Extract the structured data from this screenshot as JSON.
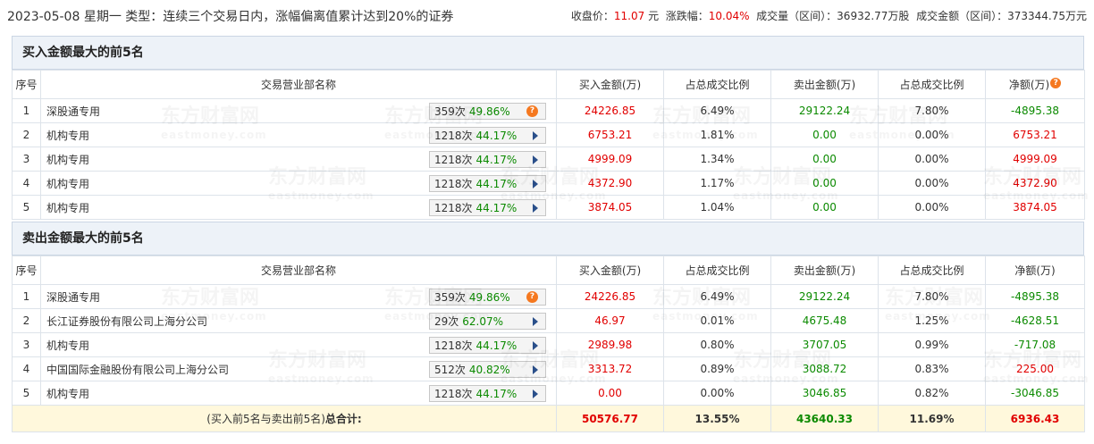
{
  "header": {
    "date": "2023-05-08",
    "weekday": "星期一",
    "type_label": "类型：",
    "type_value": "连续三个交易日内，涨幅偏离值累计达到20%的证券",
    "close_label": "收盘价：",
    "close_value": "11.07",
    "close_unit": "元",
    "change_label": "涨跌幅：",
    "change_value": "10.04%",
    "volume_label": "成交量（区间）：",
    "volume_value": "36932.77万股",
    "amount_label": "成交金额（区间）：",
    "amount_value": "373344.75万元"
  },
  "columns": {
    "seq": "序号",
    "name": "交易营业部名称",
    "buy": "买入金额(万)",
    "buy_ratio": "占总成交比例",
    "sell": "卖出金额(万)",
    "sell_ratio": "占总成交比例",
    "net": "净额(万)"
  },
  "help_icon": "question-mark-icon",
  "arrow_icon": "triangle-right-icon",
  "watermark": {
    "cn": "东方财富网",
    "en": "eastmoney.com"
  },
  "buy_section": {
    "title": "买入金额最大的前5名",
    "rows": [
      {
        "seq": "1",
        "name": "深股通专用",
        "count": "359次",
        "rate": "49.86%",
        "icon": "help",
        "buy": "24226.85",
        "buy_ratio": "6.49%",
        "sell": "29122.24",
        "sell_ratio": "7.80%",
        "net": "-4895.38",
        "net_color": "green"
      },
      {
        "seq": "2",
        "name": "机构专用",
        "count": "1218次",
        "rate": "44.17%",
        "icon": "arrow",
        "buy": "6753.21",
        "buy_ratio": "1.81%",
        "sell": "0.00",
        "sell_ratio": "0.00%",
        "net": "6753.21",
        "net_color": "red"
      },
      {
        "seq": "3",
        "name": "机构专用",
        "count": "1218次",
        "rate": "44.17%",
        "icon": "arrow",
        "buy": "4999.09",
        "buy_ratio": "1.34%",
        "sell": "0.00",
        "sell_ratio": "0.00%",
        "net": "4999.09",
        "net_color": "red"
      },
      {
        "seq": "4",
        "name": "机构专用",
        "count": "1218次",
        "rate": "44.17%",
        "icon": "arrow",
        "buy": "4372.90",
        "buy_ratio": "1.17%",
        "sell": "0.00",
        "sell_ratio": "0.00%",
        "net": "4372.90",
        "net_color": "red"
      },
      {
        "seq": "5",
        "name": "机构专用",
        "count": "1218次",
        "rate": "44.17%",
        "icon": "arrow",
        "buy": "3874.05",
        "buy_ratio": "1.04%",
        "sell": "0.00",
        "sell_ratio": "0.00%",
        "net": "3874.05",
        "net_color": "red"
      }
    ]
  },
  "sell_section": {
    "title": "卖出金额最大的前5名",
    "rows": [
      {
        "seq": "1",
        "name": "深股通专用",
        "count": "359次",
        "rate": "49.86%",
        "rate_color": "green",
        "icon": "help",
        "buy": "24226.85",
        "buy_ratio": "6.49%",
        "sell": "29122.24",
        "sell_ratio": "7.80%",
        "net": "-4895.38",
        "net_color": "green"
      },
      {
        "seq": "2",
        "name": "长江证券股份有限公司上海分公司",
        "count": "29次",
        "rate": "62.07%",
        "rate_color": "red",
        "icon": "arrow",
        "buy": "46.97",
        "buy_ratio": "0.01%",
        "sell": "4675.48",
        "sell_ratio": "1.25%",
        "net": "-4628.51",
        "net_color": "green"
      },
      {
        "seq": "3",
        "name": "机构专用",
        "count": "1218次",
        "rate": "44.17%",
        "rate_color": "green",
        "icon": "arrow",
        "buy": "2989.98",
        "buy_ratio": "0.80%",
        "sell": "3707.05",
        "sell_ratio": "0.99%",
        "net": "-717.08",
        "net_color": "green"
      },
      {
        "seq": "4",
        "name": "中国国际金融股份有限公司上海分公司",
        "count": "512次",
        "rate": "40.82%",
        "rate_color": "green",
        "icon": "arrow",
        "buy": "3313.72",
        "buy_ratio": "0.89%",
        "sell": "3088.72",
        "sell_ratio": "0.83%",
        "net": "225.00",
        "net_color": "red"
      },
      {
        "seq": "5",
        "name": "机构专用",
        "count": "1218次",
        "rate": "44.17%",
        "rate_color": "green",
        "icon": "arrow",
        "buy": "0.00",
        "buy_ratio": "0.00%",
        "sell": "3046.85",
        "sell_ratio": "0.82%",
        "net": "-3046.85",
        "net_color": "green"
      }
    ],
    "total": {
      "label_prefix": "(买入前5名与卖出前5名)",
      "label_bold": "总合计:",
      "buy": "50576.77",
      "buy_ratio": "13.55%",
      "sell": "43640.33",
      "sell_ratio": "11.69%",
      "net": "6936.43"
    }
  }
}
